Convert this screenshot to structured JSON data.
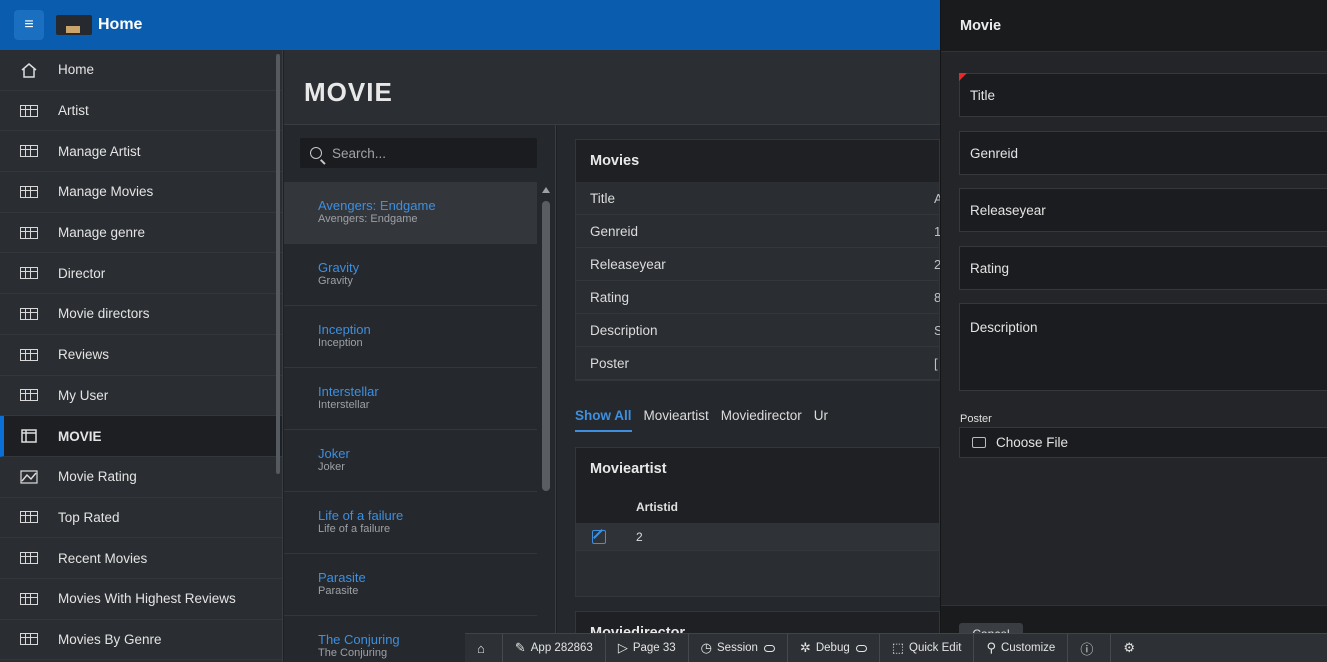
{
  "header": {
    "app_title": "Home"
  },
  "sidebar": {
    "items": [
      {
        "label": "Home",
        "icon": "home-icon"
      },
      {
        "label": "Artist",
        "icon": "table-icon"
      },
      {
        "label": "Manage Artist",
        "icon": "table-icon"
      },
      {
        "label": "Manage Movies",
        "icon": "table-icon"
      },
      {
        "label": "Manage genre",
        "icon": "table-icon"
      },
      {
        "label": "Director",
        "icon": "table-icon"
      },
      {
        "label": "Movie directors",
        "icon": "table-icon"
      },
      {
        "label": "Reviews",
        "icon": "table-icon"
      },
      {
        "label": "My User",
        "icon": "table-icon"
      },
      {
        "label": "MOVIE",
        "icon": "window-icon",
        "active": true
      },
      {
        "label": "Movie Rating",
        "icon": "line-chart-icon"
      },
      {
        "label": "Top Rated",
        "icon": "table-icon"
      },
      {
        "label": "Recent Movies",
        "icon": "table-icon"
      },
      {
        "label": "Movies With Highest Reviews",
        "icon": "table-icon"
      },
      {
        "label": "Movies By Genre",
        "icon": "table-icon"
      }
    ]
  },
  "page": {
    "title": "MOVIE"
  },
  "search": {
    "placeholder": "Search..."
  },
  "movies_list": [
    {
      "title": "Avengers: Endgame",
      "subtitle": "Avengers: Endgame"
    },
    {
      "title": "Gravity",
      "subtitle": "Gravity"
    },
    {
      "title": "Inception",
      "subtitle": "Inception"
    },
    {
      "title": "Interstellar",
      "subtitle": "Interstellar"
    },
    {
      "title": "Joker",
      "subtitle": "Joker"
    },
    {
      "title": "Life of a failure",
      "subtitle": "Life of a failure"
    },
    {
      "title": "Parasite",
      "subtitle": "Parasite"
    },
    {
      "title": "The Conjuring",
      "subtitle": "The Conjuring"
    }
  ],
  "detail": {
    "card_title": "Movies",
    "rows": [
      {
        "label": "Title",
        "value": "A"
      },
      {
        "label": "Genreid",
        "value": "1"
      },
      {
        "label": "Releaseyear",
        "value": "2"
      },
      {
        "label": "Rating",
        "value": "8"
      },
      {
        "label": "Description",
        "value": "S"
      },
      {
        "label": "Poster",
        "value": "["
      }
    ],
    "tabs": [
      "Show All",
      "Movieartist",
      "Moviedirector",
      "Ur"
    ],
    "movieartist": {
      "title": "Movieartist",
      "column": "Artistid",
      "value": "2"
    },
    "moviedirector": {
      "title": "Moviedirector"
    }
  },
  "dialog": {
    "title": "Movie",
    "fields": {
      "title": "Title",
      "genreid": "Genreid",
      "releaseyear": "Releaseyear",
      "rating": "Rating",
      "description": "Description"
    },
    "poster_label": "Poster",
    "choose_file": "Choose File",
    "cancel": "Cancel"
  },
  "devbar": {
    "app": "App 282863",
    "page": "Page 33",
    "session": "Session",
    "debug": "Debug",
    "quick_edit": "Quick Edit",
    "customize": "Customize"
  },
  "colors": {
    "header": "#0a5dae",
    "link": "#3e8fdf",
    "required": "#e62a2a"
  }
}
